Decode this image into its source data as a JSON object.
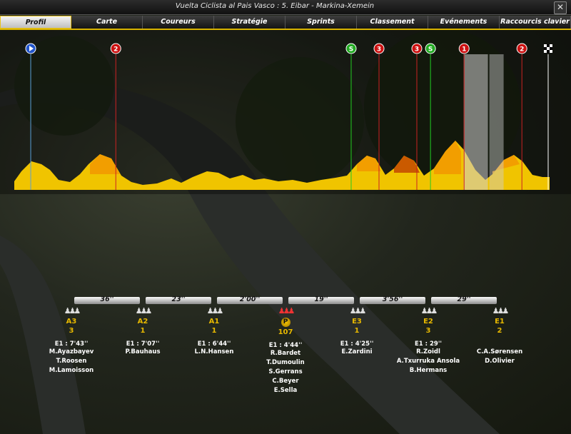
{
  "window": {
    "title": "Vuelta Ciclista al Pais Vasco : 5. Eibar - Markina-Xemein",
    "close_icon": "close-icon"
  },
  "tabs": [
    {
      "label": "Profil",
      "active": true
    },
    {
      "label": "Carte"
    },
    {
      "label": "Coureurs"
    },
    {
      "label": "Stratégie"
    },
    {
      "label": "Sprints"
    },
    {
      "label": "Classement"
    },
    {
      "label": "Evénements"
    },
    {
      "label": "Raccourcis clavier"
    }
  ],
  "profile": {
    "race_position_fraction": 0.85,
    "markers": [
      {
        "label": "",
        "kind": "start",
        "color": "#2255cc",
        "line": "#5aa0d8",
        "pos": 0.015
      },
      {
        "label": "2",
        "kind": "climb",
        "color": "#cc1111",
        "line": "#cc2222",
        "pos": 0.177
      },
      {
        "label": "S",
        "kind": "sprint",
        "color": "#22aa22",
        "line": "#22cc22",
        "pos": 0.625
      },
      {
        "label": "3",
        "kind": "climb",
        "color": "#cc1111",
        "line": "#cc2222",
        "pos": 0.678
      },
      {
        "label": "3",
        "kind": "climb",
        "color": "#cc1111",
        "line": "#cc2222",
        "pos": 0.75
      },
      {
        "label": "S",
        "kind": "sprint",
        "color": "#22aa22",
        "line": "#22cc22",
        "pos": 0.776
      },
      {
        "label": "1",
        "kind": "climb",
        "color": "#cc1111",
        "line": "#cc2222",
        "pos": 0.84
      },
      {
        "label": "2",
        "kind": "climb",
        "color": "#cc1111",
        "line": "#cc2222",
        "pos": 0.95
      },
      {
        "label": "",
        "kind": "finish",
        "color": "#ffffff",
        "line": "#ffffff",
        "pos": 1.0
      }
    ],
    "colors": {
      "terrain": "#f0c400",
      "climb": "#f29a00",
      "climb_dark": "#c04000"
    }
  },
  "gaps": [
    "36''",
    "23''",
    "2'00''",
    "19''",
    "3'56''",
    "29''"
  ],
  "groups": [
    {
      "name": "A3",
      "count": "3",
      "time": "E1 : 7'43''",
      "riders": [
        "M.Ayazbayev",
        "T.Roosen",
        "M.Lamoisson"
      ]
    },
    {
      "name": "A2",
      "count": "1",
      "time": "E1 : 7'07''",
      "riders": [
        "P.Bauhaus"
      ]
    },
    {
      "name": "A1",
      "count": "1",
      "time": "E1 : 6'44''",
      "riders": [
        "L.N.Hansen"
      ]
    },
    {
      "name": "P",
      "count": "107",
      "time": "E1 : 4'44''",
      "riders": [
        "R.Bardet",
        "T.Dumoulin",
        "S.Gerrans",
        "C.Beyer",
        "E.Sella"
      ],
      "peloton": true
    },
    {
      "name": "E3",
      "count": "1",
      "time": "E1 : 4'25''",
      "riders": [
        "E.Zardini"
      ]
    },
    {
      "name": "E2",
      "count": "3",
      "time": "E1 : 29''",
      "riders": [
        "R.Zoidl",
        "A.Txurruka Ansola",
        "B.Hermans"
      ]
    },
    {
      "name": "E1",
      "count": "2",
      "time": "",
      "riders": [
        "C.A.Sørensen",
        "D.Olivier"
      ]
    }
  ]
}
